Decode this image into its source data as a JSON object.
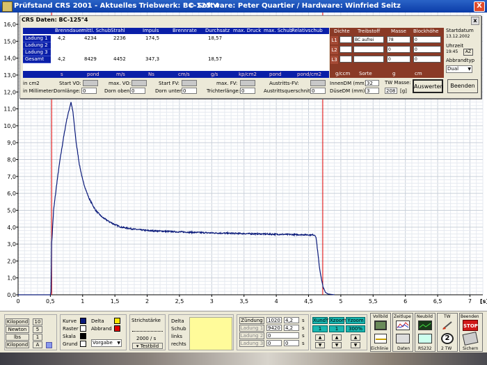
{
  "window": {
    "title": "Prüfstand CRS 2001 - Aktuelles Triebwerk: BC-125\"4",
    "software": "© Software: Peter Quartier / Hardware: Winfried Seitz",
    "close": "X"
  },
  "dialog": {
    "title": "CRS Daten: BC-125\"4",
    "close": "x",
    "columns": [
      "Brenndauer",
      "mittl. Schub",
      "Strahl",
      "Impuls",
      "Brennrate",
      "Durchsatz",
      "max. Druck",
      "max. Schub",
      "Relativschub"
    ],
    "rows": [
      {
        "label": "Ladung 1",
        "values": [
          "4,2",
          "4234",
          "2236",
          "174,5",
          "",
          "18,57",
          "",
          "",
          ""
        ]
      },
      {
        "label": "Ladung 2",
        "values": [
          "",
          "",
          "",
          "",
          "",
          "",
          "",
          "",
          ""
        ]
      },
      {
        "label": "Ladung 3",
        "values": [
          "",
          "",
          "",
          "",
          "",
          "",
          "",
          "",
          ""
        ]
      },
      {
        "label": "Gesamt",
        "values": [
          "4,2",
          "8429",
          "4452",
          "347,3",
          "",
          "18,57",
          "",
          "",
          ""
        ]
      }
    ],
    "units": [
      "s",
      "pond",
      "m/s",
      "Ns",
      "cm/s",
      "g/s",
      "kp/cm2",
      "pond",
      "pond/cm2"
    ],
    "bottom": {
      "in_cm2": "in cm2",
      "in_mm": "in Millimeter:",
      "start_vo": "Start VO:",
      "max_vo": "max. VO:",
      "start_fv": "Start FV:",
      "max_fv": "max. FV:",
      "austritts_fv": "Austritts-FV:",
      "innen_dm": "InnenDM (mm):",
      "innen_dm_val": "32",
      "dornlaenge": "Dornlänge:",
      "dornlaenge_val": "0",
      "dorn_oben": "Dorn oben:",
      "dorn_oben_val": "0",
      "dorn_unten": "Dorn unten:",
      "dorn_unten_val": "0",
      "trichterlaenge": "Trichterlänge:",
      "trichterlaenge_val": "0",
      "austrittsquerschnitt": "Austrittsquerschnitt:",
      "austrittsquerschnitt_val": "0",
      "duese_dm": "DüseDM (mm):",
      "duese_dm_val": "3",
      "tw_masse": "TW Masse:",
      "tw_masse_val": "208",
      "tw_masse_unit": "[g]",
      "auswerten": "Auswerten",
      "beenden": "Beenden"
    },
    "fuel": {
      "columns": [
        "Dichte",
        "Treibstoff",
        "Masse",
        "Blockhöhe"
      ],
      "rows": [
        {
          "label": "L1",
          "dichte": "",
          "treibstoff": "BC aufrei",
          "masse": "78",
          "block": "0"
        },
        {
          "label": "L2",
          "dichte": "",
          "treibstoff": "",
          "masse": "0",
          "block": "0"
        },
        {
          "label": "L3",
          "dichte": "",
          "treibstoff": "",
          "masse": "0",
          "block": "0"
        }
      ],
      "units": [
        "g/ccm",
        "Sorte",
        "g",
        "cm"
      ]
    },
    "side": {
      "startdatum": "Startdatum",
      "datum": "13.12.2002",
      "uhrzeit": "Uhrzeit",
      "zeit": "19:45",
      "az": "AZ",
      "abbrandtyp": "Abbrandtyp",
      "abbrand_val": "Dual"
    }
  },
  "toolbar": {
    "units": {
      "kilopond": "Kilopond",
      "newton": "Newton",
      "lbs": "lbs",
      "kilopond2": "Kilopond",
      "n10": "10",
      "n5": "5",
      "n1": "1",
      "a": "A"
    },
    "legend": {
      "kurve": "Kurve",
      "raster": "Raster",
      "skala": "Skala",
      "grund": "Grund",
      "delta": "Delta",
      "abbrand": "Abbrand",
      "vorgabe": "Vorgabe"
    },
    "strich": {
      "label": "Strichstärke",
      "rate": "2000 / s",
      "testbild": "Testbild"
    },
    "delta": {
      "delta": "Delta",
      "schub": "Schub",
      "links": "links",
      "rechts": "rechts"
    },
    "zuendung": {
      "label": "Zündung",
      "z1": "1020",
      "z2": "4,2",
      "z3": "s",
      "l1": "Ladung 1",
      "l1a": "9420",
      "l1b": "4,2",
      "l1c": "s",
      "l2": "Ladung 2",
      "l2a": "0",
      "l2b": "s",
      "l3": "Ladung 3",
      "l3a": "0",
      "l3b": "0",
      "l3c": "s"
    },
    "zoom": {
      "xundy": "XundY",
      "xzoom": "Xzoom",
      "yzoom": "Yzoom",
      "v1": "1",
      "v2": "1",
      "v3": "300%"
    },
    "tools": {
      "vollbild": "Vollbild",
      "zeitlupe": "Zeitlupe",
      "neubild": "Neubild",
      "tw": "TW",
      "beenden": "Beenden",
      "eichlinie": "Eichlinie",
      "daten": "Daten",
      "rs232": "RS232",
      "two_tw": "2 TW",
      "sichern": "Sichern",
      "stop": "STOP"
    }
  },
  "chart_data": {
    "type": "line",
    "x_ticks": [
      "0",
      "0,5",
      "1",
      "1,5",
      "2",
      "2,5",
      "3",
      "3,5",
      "4",
      "4,5",
      "5",
      "5,5",
      "6",
      "6,5",
      "7"
    ],
    "y_ticks": [
      "0,0",
      "1,0",
      "2,0",
      "3,0",
      "4,0",
      "5,0",
      "6,0",
      "7,0",
      "8,0",
      "9,0",
      "10,0",
      "11,0",
      "12,0",
      "13,0",
      "14,0",
      "15,0",
      "16,0"
    ],
    "x_unit": "[s]",
    "xlim": [
      0,
      7.2
    ],
    "ylim": [
      0,
      16.7
    ],
    "markers": [
      0.52,
      4.72
    ],
    "series": [
      {
        "color": "#0a1a7a",
        "points": [
          [
            0,
            0
          ],
          [
            0.5,
            0
          ],
          [
            0.51,
            0.2
          ],
          [
            0.52,
            3.0
          ],
          [
            0.55,
            5.0
          ],
          [
            0.6,
            6.6
          ],
          [
            0.65,
            8.0
          ],
          [
            0.7,
            9.2
          ],
          [
            0.75,
            10.3
          ],
          [
            0.8,
            11.1
          ],
          [
            0.82,
            11.4
          ],
          [
            0.85,
            10.8
          ],
          [
            0.9,
            9.0
          ],
          [
            0.95,
            7.7
          ],
          [
            1.0,
            6.8
          ],
          [
            1.05,
            6.2
          ],
          [
            1.1,
            5.7
          ],
          [
            1.2,
            5.0
          ],
          [
            1.3,
            4.6
          ],
          [
            1.4,
            4.35
          ],
          [
            1.5,
            4.15
          ],
          [
            1.6,
            4.0
          ],
          [
            1.8,
            3.88
          ],
          [
            2.0,
            3.8
          ],
          [
            2.5,
            3.72
          ],
          [
            3.0,
            3.66
          ],
          [
            3.5,
            3.62
          ],
          [
            4.0,
            3.58
          ],
          [
            4.3,
            3.56
          ],
          [
            4.5,
            3.55
          ],
          [
            4.6,
            3.54
          ],
          [
            4.62,
            3.3
          ],
          [
            4.64,
            2.6
          ],
          [
            4.67,
            1.6
          ],
          [
            4.7,
            0.9
          ],
          [
            4.73,
            0.4
          ],
          [
            4.76,
            0.15
          ],
          [
            4.8,
            0.05
          ],
          [
            4.9,
            0
          ]
        ]
      }
    ]
  }
}
